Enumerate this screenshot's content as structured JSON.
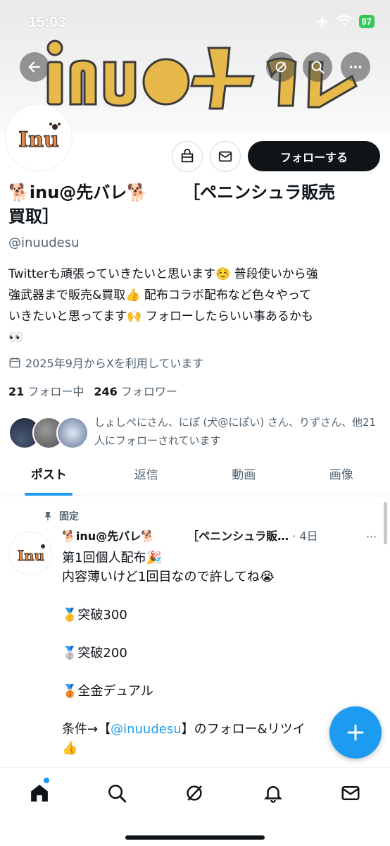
{
  "status_bar": {
    "time": "15:03",
    "battery": "97"
  },
  "banner": {
    "art_text": "inu@先バレ"
  },
  "avatar": {
    "logo_text": "Inu"
  },
  "profile": {
    "follow_label": "フォローする",
    "name_part1": "🐕inu@先バレ🐕",
    "name_part2": "［ペニンシュラ販売",
    "name_part3": "買取］",
    "handle": "@inuudesu",
    "bio_lines": [
      "Twitterも頑張っていきたいと思います☺️ 普段使いから強",
      "強武器まで販売&買取👍 配布コラボ配布など色々やって",
      "いきたいと思ってます🙌 フォローしたらいい事あるかも",
      "👀"
    ],
    "joined": "2025年9月からXを利用しています",
    "following_count": "21",
    "following_label": "フォロー中",
    "followers_count": "246",
    "followers_label": "フォロワー",
    "followed_by": "しょしぺにさん、にぽ (犬@にぽい) さん、りずさん、他21人にフォローされています"
  },
  "tabs": [
    {
      "label": "ポスト"
    },
    {
      "label": "返信"
    },
    {
      "label": "動画"
    },
    {
      "label": "画像"
    }
  ],
  "post": {
    "pinned_label": "固定",
    "author_name": "🐕inu@先バレ🐕",
    "author_suffix": "［ペニンシュラ販…",
    "time": "· 4日",
    "more": "···",
    "line1": "第1回個人配布🎉",
    "line2": "内容薄いけど1回目なので許してね😭",
    "line3": "🥇突破300",
    "line4": "🥈突破200",
    "line5": "🥉全金デュアル",
    "line6_prefix": "条件→【",
    "line6_mention": "@inuudesu",
    "line6_suffix": "】のフォロー&リツイ",
    "line7": "👍"
  },
  "colors": {
    "accent": "#1d9bf0",
    "text": "#0f1419",
    "muted": "#536471",
    "follow_bg": "#0f1419"
  },
  "icons": {
    "back": "back-arrow-icon",
    "grok": "grok-icon",
    "search": "search-icon",
    "more": "more-icon",
    "shop": "shop-icon",
    "dm": "mail-icon",
    "calendar": "calendar-icon",
    "pin": "pin-icon",
    "compose": "plus-icon",
    "home": "home-icon",
    "notifications": "bell-icon",
    "messages": "mail-icon"
  }
}
